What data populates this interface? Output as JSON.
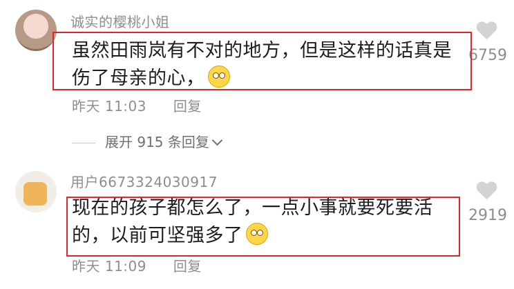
{
  "comments": [
    {
      "username": "诚实的樱桃小姐",
      "text_line1": "虽然田雨岚有不对的地方，但是这样的话真是",
      "text_line2": "伤了母亲的心，",
      "time": "昨天 11:03",
      "reply": "回复",
      "likes": "6759",
      "emoji": "pleading-face-emoji"
    },
    {
      "username": "用户6673324030917",
      "text_line1": "现在的孩子都怎么了，一点小事就要死要活",
      "text_line2": "的，以前可坚强多了",
      "time": "昨天 11:09",
      "reply": "回复",
      "likes": "2919",
      "emoji": "smile-emoji"
    }
  ],
  "expand_replies": "展开 915 条回复",
  "icons": {
    "like": "heart-icon",
    "expand": "chevron-down-icon"
  },
  "colors": {
    "highlight": "#e0262b",
    "muted": "#8d8d8d"
  }
}
